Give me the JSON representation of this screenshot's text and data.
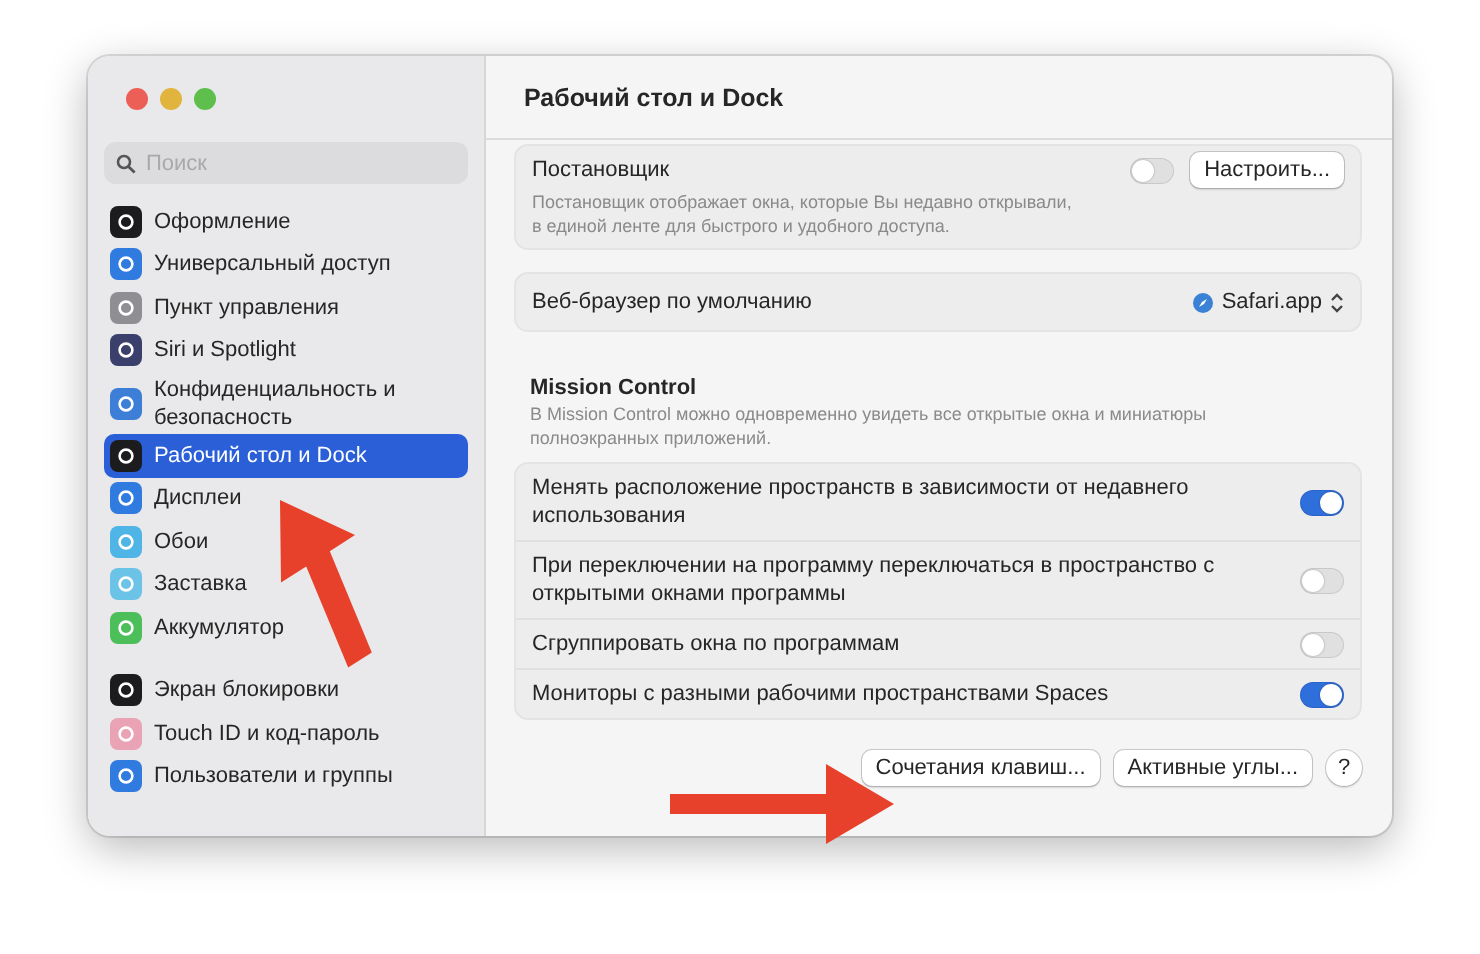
{
  "window": {
    "title": "Рабочий стол и Dock"
  },
  "sidebar": {
    "search": {
      "placeholder": "Поиск"
    },
    "sections": [
      {
        "items": [
          {
            "label": "Оформление",
            "color": "#1c1c1e",
            "selected": false
          },
          {
            "label": "Универсальный доступ",
            "color": "#2f7be0",
            "selected": false
          },
          {
            "label": "Пункт управления",
            "color": "#8e8e93",
            "selected": false
          },
          {
            "label": "Siri и Spotlight",
            "color": "#3a3f6b",
            "selected": false
          },
          {
            "label": "Конфиденциальность и безопасность",
            "color": "#3d7fd6",
            "selected": false
          },
          {
            "label": "Рабочий стол и Dock",
            "color": "#1c1c1e",
            "selected": true
          },
          {
            "label": "Дисплеи",
            "color": "#2f7be0",
            "selected": false
          },
          {
            "label": "Обои",
            "color": "#4fb4e6",
            "selected": false
          },
          {
            "label": "Заставка",
            "color": "#6cc3e8",
            "selected": false
          },
          {
            "label": "Аккумулятор",
            "color": "#4cbf5a",
            "selected": false
          }
        ]
      },
      {
        "items": [
          {
            "label": "Экран блокировки",
            "color": "#1c1c1e",
            "selected": false
          },
          {
            "label": "Touch ID и код-пароль",
            "color": "#e9a3b5",
            "selected": false
          },
          {
            "label": "Пользователи и группы",
            "color": "#2f7be0",
            "selected": false
          }
        ]
      }
    ]
  },
  "stage_manager": {
    "title": "Постановщик",
    "description": "Постановщик отображает окна, которые Вы недавно открывали,\nв единой ленте для быстрого и удобного доступа.",
    "on": false,
    "button": "Настроить..."
  },
  "default_browser": {
    "label": "Веб-браузер по умолчанию",
    "value": "Safari.app"
  },
  "mission_control": {
    "title": "Mission Control",
    "description": "В Mission Control можно одновременно увидеть все открытые окна и миниатюры полноэкранных приложений.",
    "rows": [
      {
        "label": "Менять расположение пространств в зависимости от недавнего использования",
        "on": true
      },
      {
        "label": "При переключении на программу переключаться в пространство с открытыми окнами программы",
        "on": false
      },
      {
        "label": "Сгруппировать окна по программам",
        "on": false
      },
      {
        "label": "Мониторы с разными рабочими пространствами Spaces",
        "on": true
      }
    ]
  },
  "footer_buttons": [
    {
      "label": "Сочетания клавиш...",
      "kind": "button"
    },
    {
      "label": "Активные углы...",
      "kind": "button"
    },
    {
      "label": "?",
      "kind": "help"
    }
  ]
}
